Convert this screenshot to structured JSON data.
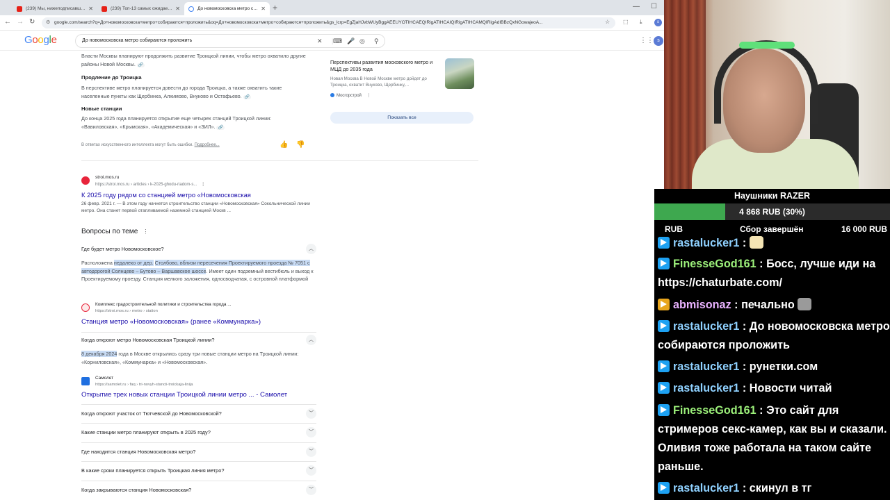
{
  "browser": {
    "tabs": [
      {
        "title": "(239) Мы, нижеподписавшиеся...",
        "favicon": "youtube-icon"
      },
      {
        "title": "(239) Топ-13 самых ожидаем...",
        "favicon": "youtube-icon"
      },
      {
        "title": "До новомосковска метро соб...",
        "favicon": "google-icon",
        "active": true
      }
    ],
    "new_tab": "+",
    "url": "google.com/search?q=До+новомосковска+метро+собираются+проложить&oq=До+новомосковска+метро+собираются+проложить&gs_lcrp=EgZjaHJvbWUyBggAEEUYOTIHCAEQIRigATIHCAIQIRigATIHCAMQIRigAdIBBzQxNGowajeoA...",
    "profile_initial": "s"
  },
  "google": {
    "logo": "Google",
    "query": "До новомосковска метро собираются проложить",
    "avatar_initial": "s"
  },
  "ai_overview": {
    "para1": "Власти Москвы планируют продолжить развитие Троицкой линии, чтобы метро охватило другие районы Новой Москвы.",
    "sec2_title": "Продление до Троицка",
    "sec2_text": "В перспективе метро планируется довести до города Троицка, а также охватить такие населенные пункты как Щербинка, Алхимово, Внуково и Остафьево.",
    "sec3_title": "Новые станции",
    "sec3_text": "До конца 2025 года планируется открытие еще четырех станций Троицкой линии: «Вавиловская», «Крымская», «Академическая» и «ЗИЛ».",
    "disclaimer": "В ответах искусственного интеллекта могут быть ошибки.",
    "disclaimer_link": "Подробнее...",
    "card_title": "Перспективы развития московского метро и МЦД до 2035 года",
    "card_desc": "Новая Москва В Новой Москве метро дойдет до Троицка, охватит Внуково, Щербинку,...",
    "card_source": "Мосгорстрой",
    "show_all": "Показать все"
  },
  "result1": {
    "site": "stroi.mos.ru",
    "path": "https://stroi.mos.ru › articles › k-2025-ghodu-riadom-s...",
    "title": "К 2025 году рядом со станцией метро «Новомосковская",
    "date": "26 февр. 2021 г.",
    "snippet_rest": " — В этом году начнется строительство станции «Новомосковская» Сокольнической линии метро. Она станет первой отапливаемой наземной станцией Москв ..."
  },
  "paa": {
    "title": "Вопросы по теме",
    "q1": "Где будет метро Новомосковское?",
    "a1_pre": "Расположена ",
    "a1_hl1": "недалеко от дер.",
    "a1_hl2": "Столбово, вблизи пересечения Проектируемого проезда № 7051 с автодорогой Солнцево – Бутово – Варшавское шоссе",
    "a1_post": ". Имеет один подземный вестибюль и выход к Проектируемому проезду. Станция мелкого заложения, односводчатая, с островной платформой",
    "a1_source_name": "Комплекс градостроительной политики и строительства города ...",
    "a1_source_path": "https://stroi.mos.ru › metro › station",
    "a1_link": "Станция метро «Новомосковская» (ранее «Коммунарка»)",
    "q2": "Когда откроют метро Новомосковская Троицкой линии?",
    "a2_hl": "8 декабря 2024",
    "a2_rest": " года в Москве открылись сразу три новые станции метро на Троицкой линии: «Корниловская», «Коммунарка» и «Новомосковская».",
    "a2_source_name": "Самолет",
    "a2_source_path": "https://samolet.ru › faq › tri-novyh-stancii-troickaja-linija",
    "a2_link": "Открытие трех новых станции Троицкой линии метро ... - Самолет",
    "q3": "Когда откроют участок от Тютчевской до Новомосковской?",
    "q4": "Какие станции метро планируют открыть в 2025 году?",
    "q5": "Где находится станция Новомосковская метро?",
    "q6": "В какие сроки планируется открыть Троицкая линия метро?",
    "q7": "Когда закрываются станция Новомосковская?"
  },
  "donation": {
    "title": "Наушники RAZER",
    "amount": "4 868 RUB (30%)",
    "progress_percent": 30,
    "left_label": "RUB",
    "status": "Сбор завершён",
    "goal": "16 000 RUB",
    "fill_color": "#3ea84f"
  },
  "chat": [
    {
      "user": "rastalucker1",
      "color": "#8fd1ff",
      "text": "",
      "emote": "e1"
    },
    {
      "user": "FinesseGod161",
      "color": "#9cf07a",
      "text": "Босс, лучше иди на https://chaturbate.com/"
    },
    {
      "user": "abmisonaz",
      "color": "#e9b2ff",
      "text": "печально",
      "emote": "e2",
      "badge": "gold"
    },
    {
      "user": "rastalucker1",
      "color": "#8fd1ff",
      "text": "До новомосковска метро собираются проложить"
    },
    {
      "user": "rastalucker1",
      "color": "#8fd1ff",
      "text": "рунетки.сом"
    },
    {
      "user": "rastalucker1",
      "color": "#8fd1ff",
      "text": "Новости читай"
    },
    {
      "user": "FinesseGod161",
      "color": "#9cf07a",
      "text": "Это сайт для стримеров секс-камер, как вы и сказали. Оливия тоже работала на таком сайте раньше."
    },
    {
      "user": "rastalucker1",
      "color": "#8fd1ff",
      "text": "скинул в тг"
    }
  ],
  "chat_sep": " : "
}
